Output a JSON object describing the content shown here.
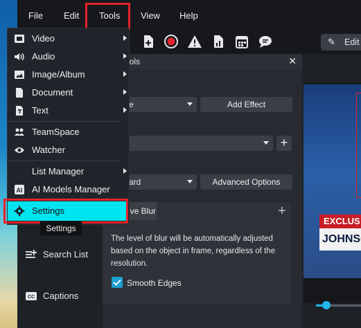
{
  "menu": {
    "file": "File",
    "edit": "Edit",
    "tools": "Tools",
    "view": "View",
    "help": "Help"
  },
  "toolbar": {
    "icons": [
      "wrench-icon",
      "add-file-icon",
      "record-icon",
      "warning-icon",
      "report-icon",
      "calendar-icon",
      "chat-icon"
    ],
    "edit_button": "Edit M"
  },
  "tools_menu": {
    "items": [
      {
        "label": "Video",
        "icon": "video-icon",
        "has_submenu": true
      },
      {
        "label": "Audio",
        "icon": "audio-icon",
        "has_submenu": true
      },
      {
        "label": "Image/Album",
        "icon": "image-icon",
        "has_submenu": true
      },
      {
        "label": "Document",
        "icon": "document-icon",
        "has_submenu": true
      },
      {
        "label": "Text",
        "icon": "text-icon",
        "has_submenu": true
      },
      {
        "label": "TeamSpace",
        "icon": "team-icon",
        "has_submenu": false
      },
      {
        "label": "Watcher",
        "icon": "eye-icon",
        "has_submenu": false
      },
      {
        "label": "List Manager",
        "icon": "",
        "has_submenu": true
      },
      {
        "label": "AI Models Manager",
        "icon": "ai-icon",
        "has_submenu": false
      },
      {
        "label": "Settings",
        "icon": "gear-icon",
        "has_submenu": false
      }
    ],
    "tooltip": "Settings"
  },
  "sidebar": {
    "items": [
      {
        "label": "Search List",
        "icon": "search-list-icon"
      },
      {
        "label": "Captions",
        "icon": "captions-icon"
      }
    ]
  },
  "panel": {
    "title": "ools",
    "dropdown1": "ngle",
    "add_effect": "Add Effect",
    "section_label": "ns",
    "dropdown3": "ard",
    "advanced_options": "Advanced Options",
    "tab_label": "ive Blur",
    "description": "The level of blur will be automatically adjusted based on the object in frame, regardless of the resolution.",
    "smooth_edges": "Smooth Edges",
    "smooth_edges_checked": true
  },
  "preview": {
    "headline_top": "EXCLUS",
    "headline_name": "JOHNSO"
  },
  "colors": {
    "accent": "#00e5f0",
    "highlight_border": "#e1242a",
    "check": "#1a9fd0"
  }
}
